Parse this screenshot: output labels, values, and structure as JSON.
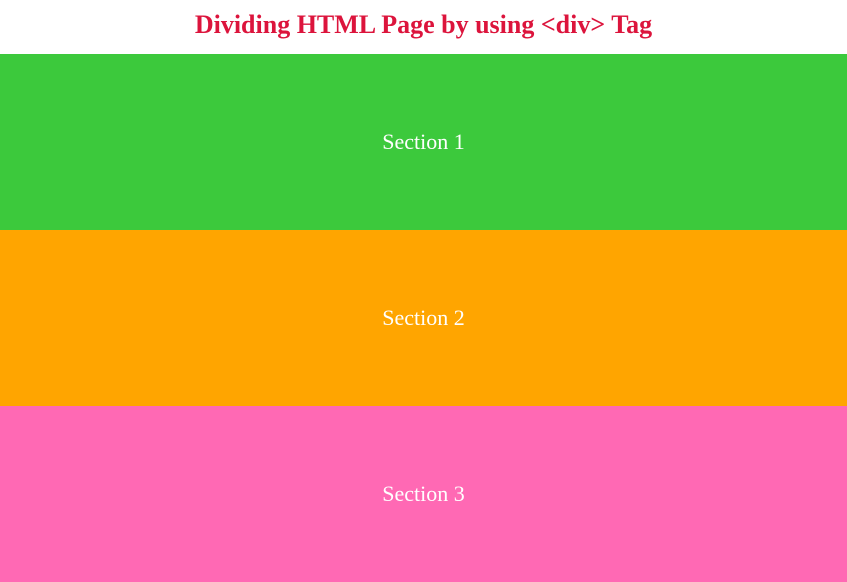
{
  "title": "Dividing HTML Page by using <div> Tag",
  "sections": [
    {
      "label": "Section 1",
      "color": "#3cc93c"
    },
    {
      "label": "Section 2",
      "color": "#ffa500"
    },
    {
      "label": "Section 3",
      "color": "#ff69b4"
    }
  ]
}
